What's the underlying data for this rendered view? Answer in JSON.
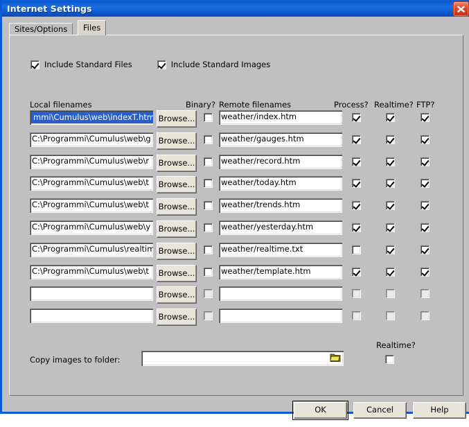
{
  "window": {
    "title": "Internet Settings",
    "close_icon": "close-icon"
  },
  "tabs": [
    {
      "label": "Sites/Options",
      "active": false
    },
    {
      "label": "Files",
      "active": true
    }
  ],
  "options": {
    "include_standard_files": {
      "label": "Include Standard Files",
      "checked": true
    },
    "include_standard_images": {
      "label": "Include Standard Images",
      "checked": true
    }
  },
  "columns": {
    "local": "Local filenames",
    "binary": "Binary?",
    "remote": "Remote filenames",
    "process": "Process?",
    "realtime": "Realtime?",
    "ftp": "FTP?"
  },
  "browse_label": "Browse...",
  "rows": [
    {
      "local": "mmi\\Cumulus\\web\\indexT.htm",
      "local_selected": true,
      "binary": false,
      "remote": "weather/index.htm",
      "process": true,
      "realtime": true,
      "ftp": true,
      "disabled": false
    },
    {
      "local": "C:\\Programmi\\Cumulus\\web\\g",
      "local_selected": false,
      "binary": false,
      "remote": "weather/gauges.htm",
      "process": true,
      "realtime": true,
      "ftp": true,
      "disabled": false
    },
    {
      "local": "C:\\Programmi\\Cumulus\\web\\r",
      "local_selected": false,
      "binary": false,
      "remote": "weather/record.htm",
      "process": true,
      "realtime": true,
      "ftp": true,
      "disabled": false
    },
    {
      "local": "C:\\Programmi\\Cumulus\\web\\t",
      "local_selected": false,
      "binary": false,
      "remote": "weather/today.htm",
      "process": true,
      "realtime": true,
      "ftp": true,
      "disabled": false
    },
    {
      "local": "C:\\Programmi\\Cumulus\\web\\t",
      "local_selected": false,
      "binary": false,
      "remote": "weather/trends.htm",
      "process": true,
      "realtime": true,
      "ftp": true,
      "disabled": false
    },
    {
      "local": "C:\\Programmi\\Cumulus\\web\\y",
      "local_selected": false,
      "binary": false,
      "remote": "weather/yesterday.htm",
      "process": true,
      "realtime": true,
      "ftp": true,
      "disabled": false
    },
    {
      "local": "C:\\Programmi\\Cumulus\\realtim",
      "local_selected": false,
      "binary": false,
      "remote": "weather/realtime.txt",
      "process": false,
      "realtime": true,
      "ftp": true,
      "disabled": false
    },
    {
      "local": "C:\\Programmi\\Cumulus\\web\\t",
      "local_selected": false,
      "binary": false,
      "remote": "weather/template.htm",
      "process": true,
      "realtime": true,
      "ftp": true,
      "disabled": false
    },
    {
      "local": "",
      "local_selected": false,
      "binary": false,
      "remote": "",
      "process": false,
      "realtime": false,
      "ftp": false,
      "disabled": true
    },
    {
      "local": "",
      "local_selected": false,
      "binary": false,
      "remote": "",
      "process": false,
      "realtime": false,
      "ftp": false,
      "disabled": true
    }
  ],
  "copy_images": {
    "label": "Copy images to folder:",
    "value": "",
    "folder_icon": "folder-icon",
    "realtime_label": "Realtime?",
    "realtime_checked": false
  },
  "buttons": {
    "ok": "OK",
    "cancel": "Cancel",
    "help": "Help"
  },
  "colors": {
    "titlebar_blue": "#1165dd",
    "window_border": "#0a5bd3",
    "dialog_face": "#c0c0c0",
    "button_face": "#e8e4d8",
    "selection_blue": "#2a5fc8",
    "close_red": "#c62a10"
  }
}
